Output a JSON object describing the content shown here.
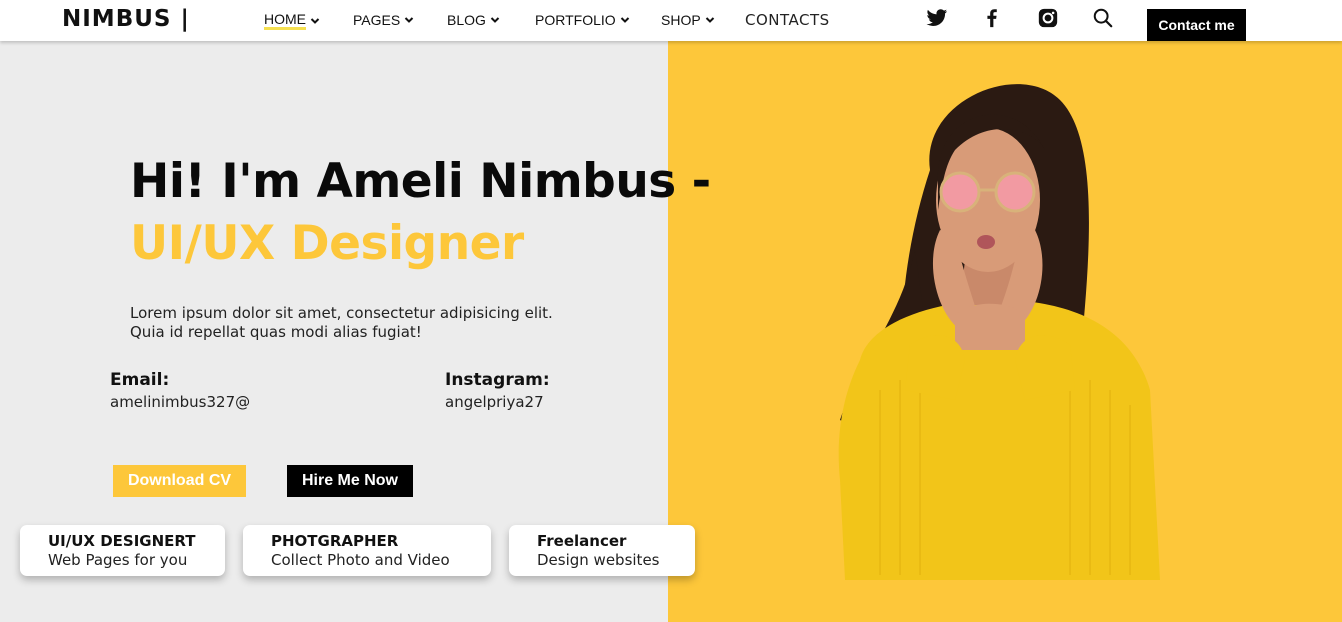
{
  "header": {
    "logo": "NIMBUS |",
    "nav": [
      {
        "label": "HOME",
        "dropdown": true,
        "active": true
      },
      {
        "label": "PAGES",
        "dropdown": true
      },
      {
        "label": "BLOG",
        "dropdown": true
      },
      {
        "label": "PORTFOLIO",
        "dropdown": true
      },
      {
        "label": "SHOP",
        "dropdown": true
      },
      {
        "label": "CONTACTS",
        "dropdown": false
      }
    ],
    "social_icons": [
      "twitter-icon",
      "facebook-icon",
      "instagram-icon",
      "search-icon"
    ],
    "contact_button": "Contact me"
  },
  "hero": {
    "title_line1": "Hi! I'm Ameli Nimbus -",
    "title_line2": "UI/UX Designer",
    "description_line1": "Lorem ipsum dolor sit amet, consectetur adipisicing elit.",
    "description_line2": "Quia id repellat quas modi alias fugiat!",
    "email_label": "Email:",
    "email_value": "amelinimbus327@",
    "instagram_label": "Instagram:",
    "instagram_value": "angelpriya27",
    "download_button": "Download CV",
    "hire_button": "Hire Me Now"
  },
  "cards": [
    {
      "title": "UI/UX DESIGNERT",
      "subtitle": "Web Pages for you"
    },
    {
      "title": "PHOTGRAPHER",
      "subtitle": "Collect Photo and Video"
    },
    {
      "title": "Freelancer",
      "subtitle": "Design websites"
    }
  ],
  "colors": {
    "accent": "#fdc73a",
    "left_background": "#ececec",
    "dark": "#000000",
    "nav_underline": "#f5e050"
  }
}
